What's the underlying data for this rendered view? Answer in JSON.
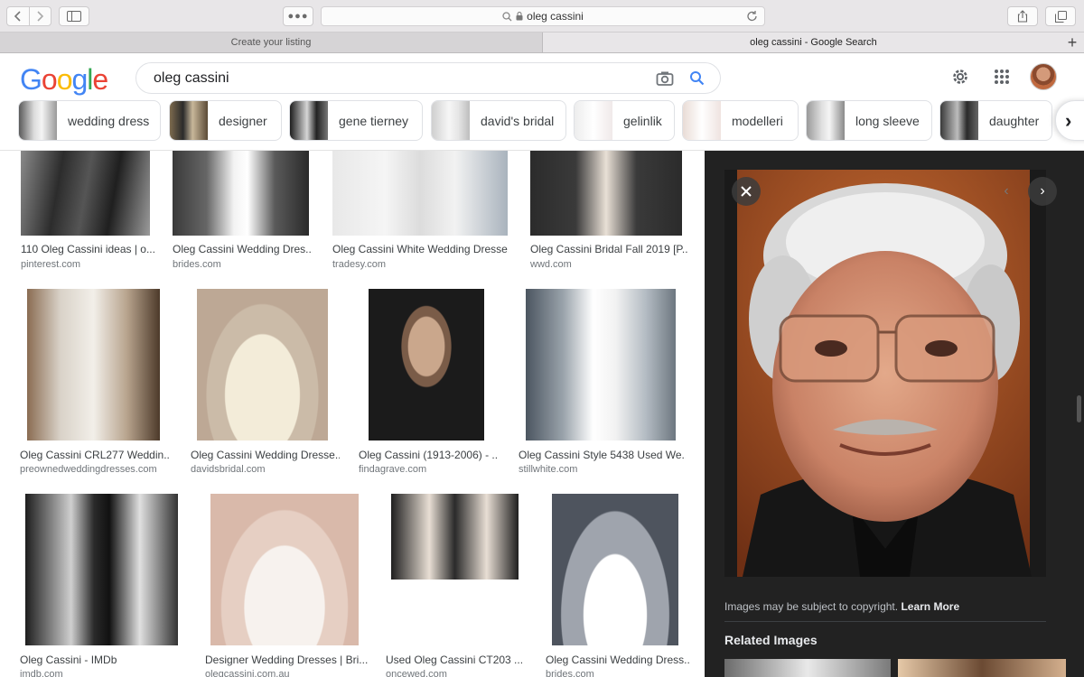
{
  "browser": {
    "address": "oleg cassini",
    "tabs": [
      "Create your listing",
      "oleg cassini - Google Search"
    ]
  },
  "google": {
    "logo_letters": [
      {
        "ch": "G",
        "color": "#4285F4"
      },
      {
        "ch": "o",
        "color": "#EA4335"
      },
      {
        "ch": "o",
        "color": "#FBBC05"
      },
      {
        "ch": "g",
        "color": "#4285F4"
      },
      {
        "ch": "l",
        "color": "#34A853"
      },
      {
        "ch": "e",
        "color": "#EA4335"
      }
    ],
    "query": "oleg cassini",
    "chips": [
      "wedding dress",
      "designer",
      "gene tierney",
      "david's bridal",
      "gelinlik",
      "modelleri",
      "long sleeve",
      "daughter"
    ]
  },
  "results": [
    {
      "title": "110 Oleg Cassini ideas | o...",
      "source": "pinterest.com"
    },
    {
      "title": "Oleg Cassini Wedding Dres...",
      "source": "brides.com"
    },
    {
      "title": "Oleg Cassini White Wedding Dresse...",
      "source": "tradesy.com"
    },
    {
      "title": "Oleg Cassini Bridal Fall 2019 [P...",
      "source": "wwd.com"
    },
    {
      "title": "Oleg Cassini CRL277 Weddin...",
      "source": "preownedweddingdresses.com"
    },
    {
      "title": "Oleg Cassini Wedding Dresse...",
      "source": "davidsbridal.com"
    },
    {
      "title": "Oleg Cassini (1913-2006) - ...",
      "source": "findagrave.com"
    },
    {
      "title": "Oleg Cassini Style 5438 Used We...",
      "source": "stillwhite.com"
    },
    {
      "title": "Oleg Cassini - IMDb",
      "source": "imdb.com"
    },
    {
      "title": "Designer Wedding Dresses | Bri...",
      "source": "olegcassini.com.au"
    },
    {
      "title": "Used Oleg Cassini CT203 ...",
      "source": "oncewed.com"
    },
    {
      "title": "Oleg Cassini Wedding Dress...",
      "source": "brides.com"
    }
  ],
  "panel": {
    "copyright_text": "Images may be subject to copyright.",
    "learn_more": "Learn More",
    "related_heading": "Related Images"
  }
}
